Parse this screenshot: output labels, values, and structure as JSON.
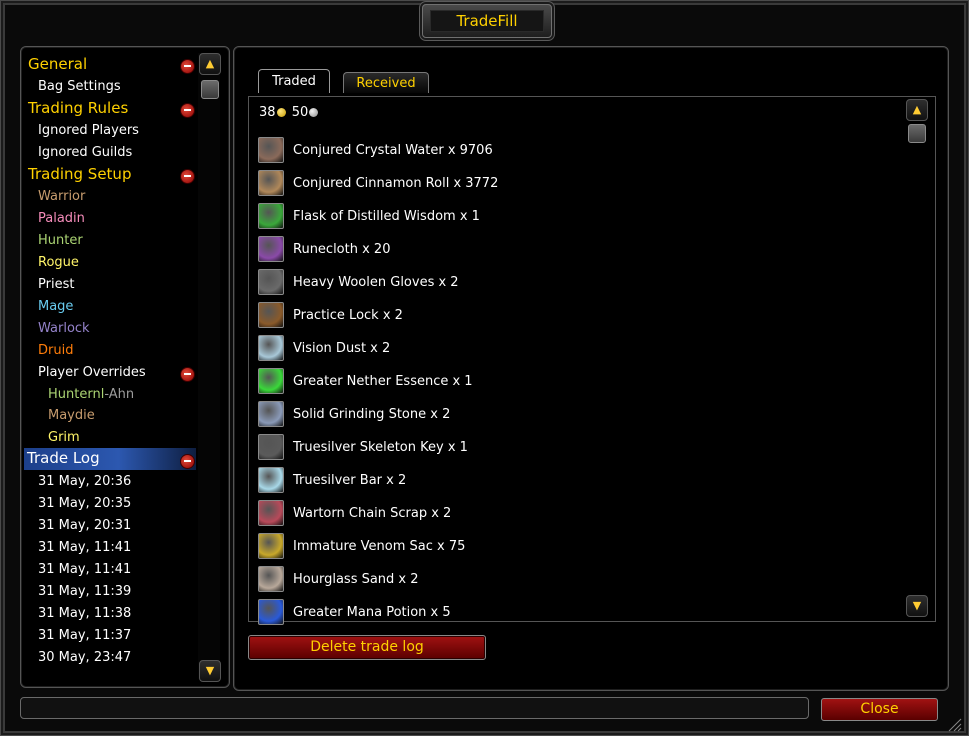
{
  "window": {
    "title": "TradeFill"
  },
  "nav": {
    "general": "General",
    "bag_settings": "Bag Settings",
    "trading_rules": "Trading Rules",
    "ignored_players": "Ignored Players",
    "ignored_guilds": "Ignored Guilds",
    "trading_setup": "Trading Setup",
    "classes": [
      {
        "label": "Warrior",
        "color": "#C79C6E"
      },
      {
        "label": "Paladin",
        "color": "#F58CBA"
      },
      {
        "label": "Hunter",
        "color": "#ABD473"
      },
      {
        "label": "Rogue",
        "color": "#FFF569"
      },
      {
        "label": "Priest",
        "color": "#FFFFFF"
      },
      {
        "label": "Mage",
        "color": "#69CCF0"
      },
      {
        "label": "Warlock",
        "color": "#9482C9"
      },
      {
        "label": "Druid",
        "color": "#FF7D0A"
      }
    ],
    "player_overrides": "Player Overrides",
    "overrides": [
      {
        "name": "Hunternl",
        "realm": "-Ahn",
        "color": "#ABD473"
      },
      {
        "name": "Maydie",
        "realm": "",
        "color": "#C79C6E"
      },
      {
        "name": "Grim",
        "realm": "",
        "color": "#FFF569"
      }
    ],
    "trade_log": "Trade Log",
    "log_dates": [
      "31 May, 20:36",
      "31 May, 20:35",
      "31 May, 20:31",
      "31 May, 11:41",
      "31 May, 11:41",
      "31 May, 11:39",
      "31 May, 11:38",
      "31 May, 11:37",
      "30 May, 23:47"
    ]
  },
  "tabs": {
    "traded": "Traded",
    "received": "Received"
  },
  "money": {
    "gold": "38",
    "silver": "50"
  },
  "items": [
    {
      "label": "Conjured Crystal Water x 9706",
      "icon": "water-icon",
      "color": "#8a6a5a"
    },
    {
      "label": "Conjured Cinnamon Roll x 3772",
      "icon": "cinnamon-roll-icon",
      "color": "#b0885a"
    },
    {
      "label": "Flask of Distilled Wisdom x 1",
      "icon": "flask-icon",
      "color": "#3aa83a"
    },
    {
      "label": "Runecloth x 20",
      "icon": "runecloth-icon",
      "color": "#8a4aa8"
    },
    {
      "label": "Heavy Woolen Gloves x 2",
      "icon": "gloves-icon",
      "color": "#6a6a6a"
    },
    {
      "label": "Practice Lock x 2",
      "icon": "lockbox-icon",
      "color": "#8a5a2a"
    },
    {
      "label": "Vision Dust x 2",
      "icon": "dust-icon",
      "color": "#a8c8d8"
    },
    {
      "label": "Greater Nether Essence x 1",
      "icon": "essence-icon",
      "color": "#3ad83a"
    },
    {
      "label": "Solid Grinding Stone x 2",
      "icon": "stone-icon",
      "color": "#8a9ab8"
    },
    {
      "label": "Truesilver Skeleton Key x 1",
      "icon": "key-icon",
      "color": "#5a5a5a"
    },
    {
      "label": "Truesilver Bar x 2",
      "icon": "bar-icon",
      "color": "#a8d8e8"
    },
    {
      "label": "Wartorn Chain Scrap x 2",
      "icon": "chain-icon",
      "color": "#b84a5a"
    },
    {
      "label": "Immature Venom Sac x 75",
      "icon": "venom-sac-icon",
      "color": "#c8a82a"
    },
    {
      "label": "Hourglass Sand x 2",
      "icon": "sand-icon",
      "color": "#b8a89a"
    },
    {
      "label": "Greater Mana Potion x 5",
      "icon": "potion-icon",
      "color": "#2a5ad8"
    }
  ],
  "buttons": {
    "delete": "Delete trade log",
    "close": "Close"
  },
  "colors": {
    "accent": "#FFD100",
    "selection": "#2C58B0",
    "button_red": "#A11212"
  }
}
